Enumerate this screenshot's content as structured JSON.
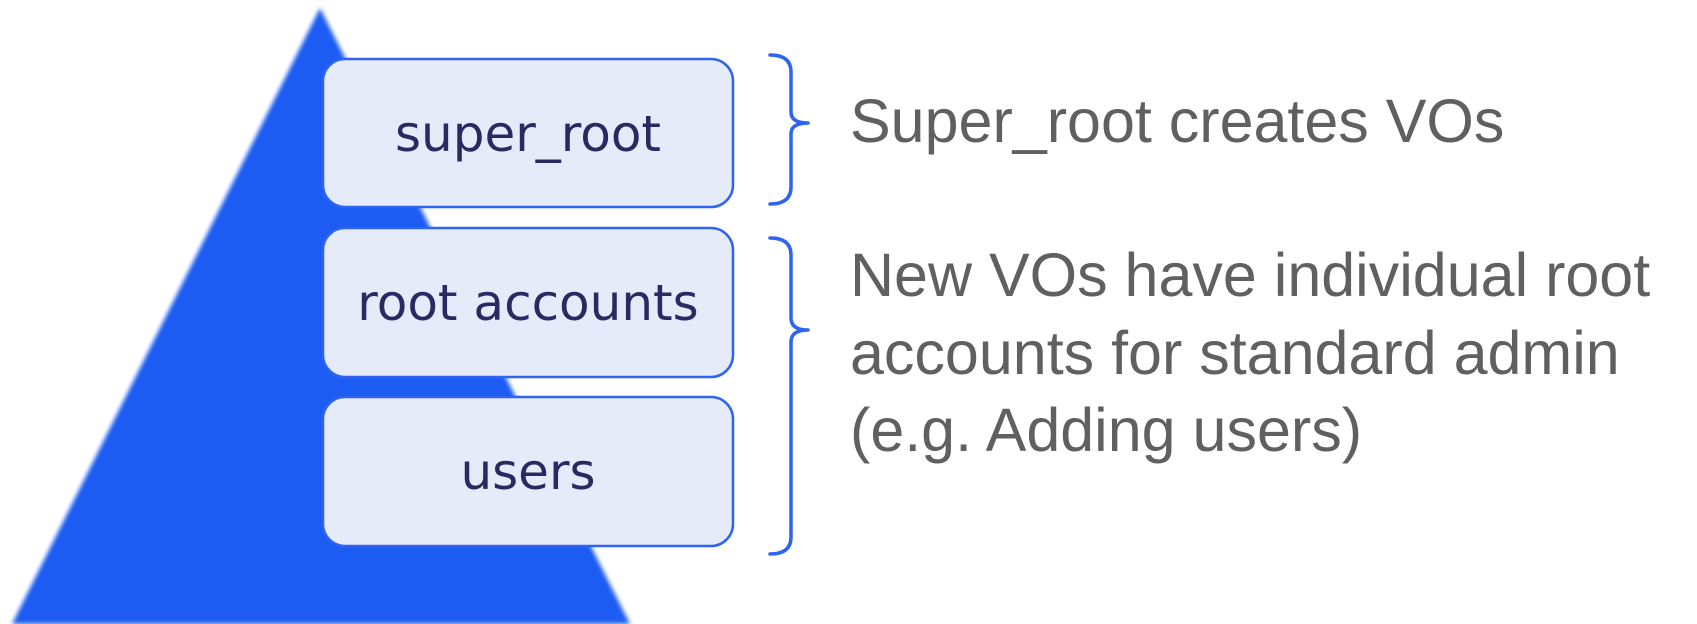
{
  "colors": {
    "pyramid": "#1f5cf2",
    "box_fill": "#e6ebfa",
    "box_border": "#2f63f0",
    "box_text": "#2a2a62",
    "bracket": "#2f63f0",
    "description_text": "#606060"
  },
  "hierarchy": {
    "levels": [
      {
        "label": "super_root"
      },
      {
        "label": "root accounts"
      },
      {
        "label": "users"
      }
    ]
  },
  "descriptions": {
    "super_root": {
      "lines": [
        "Super_root creates VOs"
      ]
    },
    "root_and_users": {
      "lines": [
        "New VOs have individual root",
        "accounts for standard admin",
        "(e.g. Adding users)"
      ]
    }
  }
}
